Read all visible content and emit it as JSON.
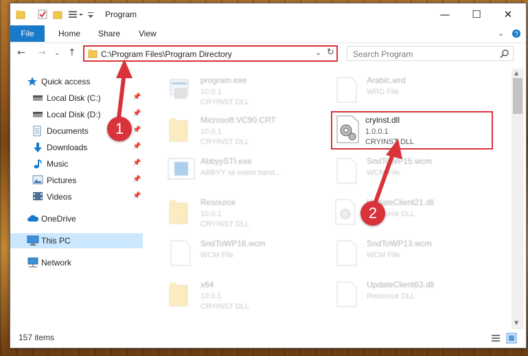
{
  "window": {
    "title": "Program",
    "controls": {
      "minimize": "—",
      "maximize": "☐",
      "close": "✕"
    }
  },
  "ribbon": {
    "tabs": [
      "File",
      "Home",
      "Share",
      "View"
    ]
  },
  "navigation": {
    "back": "←",
    "forward": "→",
    "up": "↑",
    "address": "C:\\Program Files\\Program Directory",
    "refresh": "↻",
    "search_placeholder": "Search Program"
  },
  "sidebar": {
    "items": [
      {
        "label": "Quick access",
        "icon": "star-icon",
        "pinned": false
      },
      {
        "label": "Local Disk (C:)",
        "icon": "drive-icon",
        "pinned": true
      },
      {
        "label": "Local Disk (D:)",
        "icon": "drive-icon",
        "pinned": true
      },
      {
        "label": "Documents",
        "icon": "documents-icon",
        "pinned": true
      },
      {
        "label": "Downloads",
        "icon": "download-icon",
        "pinned": true
      },
      {
        "label": "Music",
        "icon": "music-icon",
        "pinned": true
      },
      {
        "label": "Pictures",
        "icon": "pictures-icon",
        "pinned": true
      },
      {
        "label": "Videos",
        "icon": "videos-icon",
        "pinned": true
      },
      {
        "label": "OneDrive",
        "icon": "cloud-icon",
        "pinned": false
      },
      {
        "label": "This PC",
        "icon": "computer-icon",
        "pinned": false,
        "selected": true
      },
      {
        "label": "Network",
        "icon": "network-icon",
        "pinned": false
      }
    ]
  },
  "files": [
    {
      "name": "program.exe",
      "line2": "10.0.1",
      "line3": "CRYINST DLL",
      "icon": "exe-icon"
    },
    {
      "name": "Arabic.wrd",
      "line2": "WRD File",
      "line3": "",
      "icon": "blank-file-icon"
    },
    {
      "name": "Microsoft.VC90.CRT",
      "line2": "10.0.1",
      "line3": "CRYINST DLL",
      "icon": "folder-icon"
    },
    {
      "name": "cryinst.dll",
      "line2": "1.0.0.1",
      "line3": "CRYINST DLL",
      "icon": "dll-gear-icon"
    },
    {
      "name": "AbbyySTI.exe",
      "line2": "ABBYY sti event hand...",
      "line3": "",
      "icon": "exe-icon"
    },
    {
      "name": "SndToWP15.wcm",
      "line2": "WCM File",
      "line3": "",
      "icon": "blank-file-icon"
    },
    {
      "name": "Resource",
      "line2": "10.0.1",
      "line3": "CRYINST DLL",
      "icon": "folder-icon"
    },
    {
      "name": "UpdateClient21.dll",
      "line2": "Resource DLL",
      "line3": "",
      "icon": "dll-gear-icon"
    },
    {
      "name": "SndToWP16.wcm",
      "line2": "WCM File",
      "line3": "",
      "icon": "blank-file-icon"
    },
    {
      "name": "SndToWP13.wcm",
      "line2": "WCM File",
      "line3": "",
      "icon": "blank-file-icon"
    },
    {
      "name": "x64",
      "line2": "10.0.1",
      "line3": "CRYINST DLL",
      "icon": "folder-icon"
    },
    {
      "name": "UpdateClient63.dll",
      "line2": "Resource DLL",
      "line3": "",
      "icon": "dll-gear-icon"
    }
  ],
  "status": {
    "item_count": "157 items"
  },
  "annotations": {
    "step1": "1",
    "step2": "2"
  },
  "colors": {
    "accent": "#1979ca",
    "highlight": "#d9323a",
    "selection": "#cce8ff"
  }
}
